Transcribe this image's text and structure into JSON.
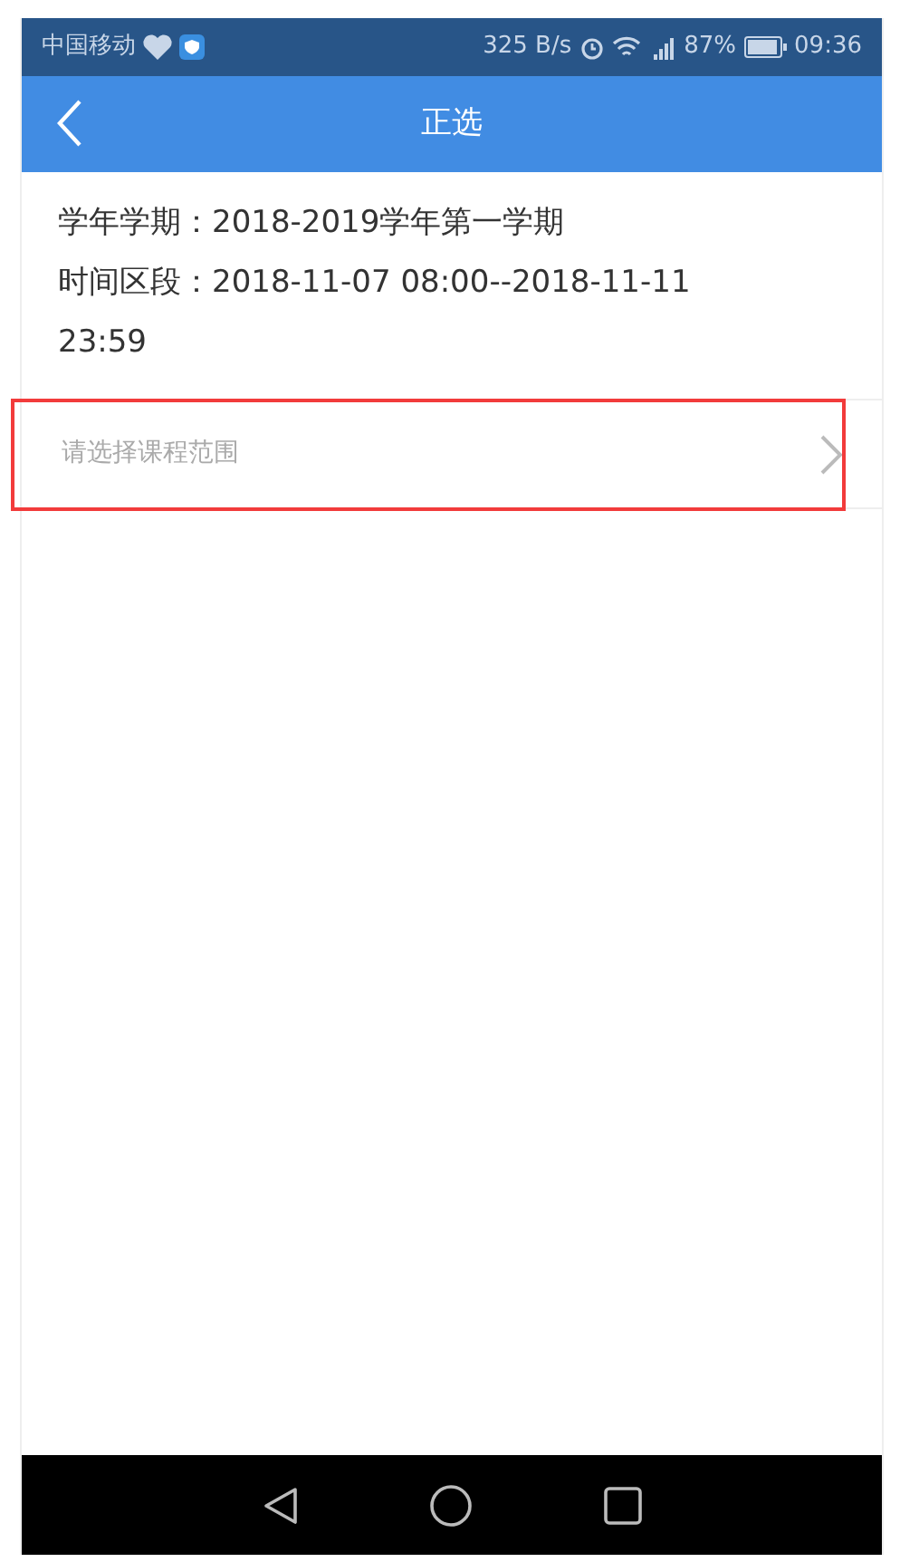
{
  "status_bar": {
    "carrier": "中国移动",
    "speed": "325 B/s",
    "battery": "87%",
    "time": "09:36"
  },
  "app_bar": {
    "title": "正选"
  },
  "info": [
    "学年学期：2018-2019学年第一学期",
    "时间区段：2018-11-07  08:00--2018-11-11 23:59"
  ],
  "selector": {
    "placeholder": "请选择课程范围",
    "highlighted": true
  }
}
